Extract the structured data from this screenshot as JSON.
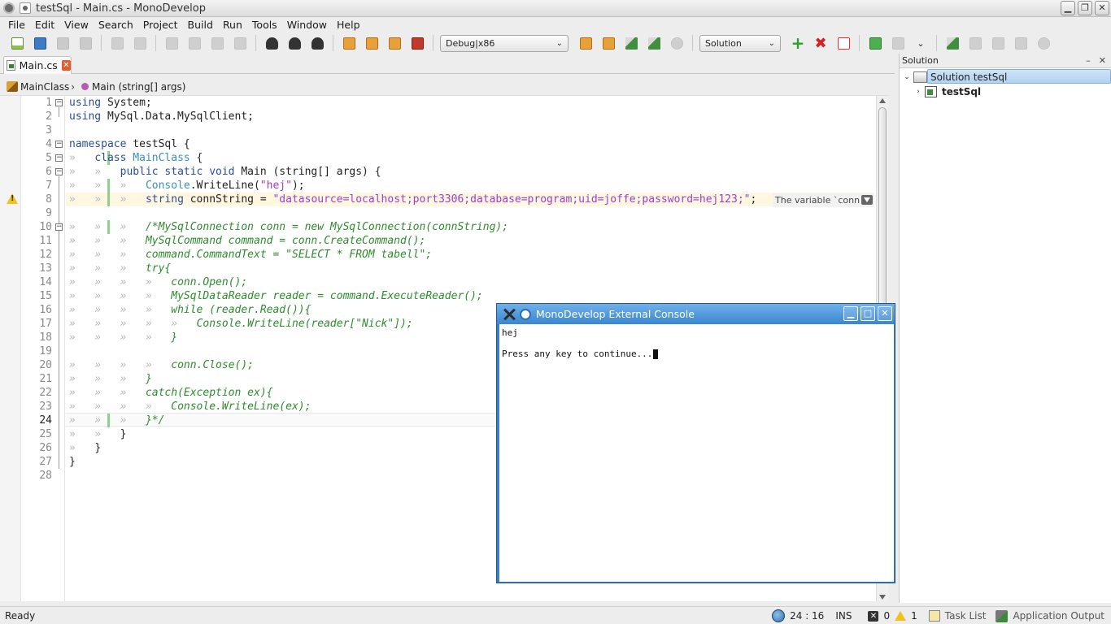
{
  "window": {
    "title": "testSql - Main.cs - MonoDevelop"
  },
  "menu": [
    "File",
    "Edit",
    "View",
    "Search",
    "Project",
    "Build",
    "Run",
    "Tools",
    "Window",
    "Help"
  ],
  "toolbar": {
    "config": "Debug|x86",
    "scope": "Solution"
  },
  "editor_tab": {
    "label": "Main.cs"
  },
  "breadcrumb": {
    "class_name": "MainClass",
    "method_name": "Main (string[] args)"
  },
  "warning_bubble": "The variable `conn",
  "code": {
    "line_numbers": [
      "1",
      "2",
      "3",
      "4",
      "5",
      "6",
      "7",
      "8",
      "9",
      "10",
      "11",
      "12",
      "13",
      "14",
      "15",
      "16",
      "17",
      "18",
      "19",
      "20",
      "21",
      "22",
      "23",
      "24",
      "25",
      "26",
      "27",
      "28"
    ],
    "l1": {
      "kw": "using",
      "rest": " System;"
    },
    "l2": {
      "kw": "using",
      "rest": " MySql.Data.MySqlClient;"
    },
    "l4": {
      "kw": "namespace",
      "rest": " testSql {"
    },
    "l5": {
      "kw": "class",
      "type": "MainClass",
      "rest": " {"
    },
    "l6": {
      "kw": "public static void",
      "rest": " Main (string[] args) {"
    },
    "l7": {
      "type": "Console",
      "rest": ".WriteLine(",
      "str": "\"hej\"",
      "end": ");"
    },
    "l8": {
      "kw": "string",
      "rest": " connString = ",
      "str": "\"datasource=localhost;port3306;database=program;uid=joffe;password=hej123;\"",
      "end": ";"
    },
    "l10": "/*MySqlConnection conn = new MySqlConnection(connString);",
    "l11": "MySqlCommand command = conn.CreateCommand();",
    "l12": "command.CommandText = \"SELECT * FROM tabell\";",
    "l13": "try{",
    "l14": "conn.Open();",
    "l15": "MySqlDataReader reader = command.ExecuteReader();",
    "l16": "while (reader.Read()){",
    "l17": "Console.WriteLine(reader[\"Nick\"]);",
    "l18": "}",
    "l20": "conn.Close();",
    "l21": "}",
    "l22": "catch(Exception ex){",
    "l23": "Console.WriteLine(ex);",
    "l24": "}*/",
    "l25": "}",
    "l26": "}",
    "l27": "}",
    "tab_glyph": "»"
  },
  "solution": {
    "header": "Solution",
    "root": "Solution testSql",
    "project": "testSql"
  },
  "status": {
    "ready": "Ready",
    "position": "24 : 16",
    "mode": "INS",
    "errors": "0",
    "warnings": "1",
    "task_list": "Task List",
    "app_output": "Application Output"
  },
  "console": {
    "title": "MonoDevelop External Console",
    "line1": "hej",
    "line2": "Press any key to continue..."
  }
}
